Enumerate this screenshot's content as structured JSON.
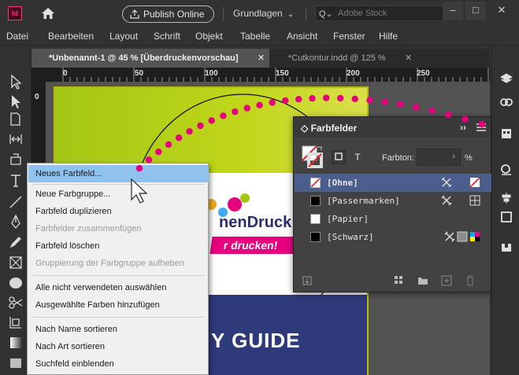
{
  "titlebar": {
    "app_logo": "Id",
    "publish_label": "Publish Online",
    "workspace_label": "Grundlagen",
    "search_placeholder": "Adobe Stock",
    "minimize": "–",
    "maximize": "□",
    "close": "✕"
  },
  "menu": [
    "Datei",
    "Bearbeiten",
    "Layout",
    "Schrift",
    "Objekt",
    "Tabelle",
    "Ansicht",
    "Fenster",
    "Hilfe"
  ],
  "tabs": [
    {
      "label": "*Unbenannt-1 @ 45 % [Überdruckenvorschau]",
      "close": "✕"
    },
    {
      "label": "*Cutkontur.indd @ 125 %",
      "close": "✕"
    }
  ],
  "ruler": {
    "ticks": [
      "0",
      "50",
      "100",
      "150",
      "200",
      "250"
    ],
    "side": "0"
  },
  "document": {
    "logo_prefix": "nen",
    "logo_word": "Druck",
    "slogan": "r drucken!",
    "guide": "Y GUIDE"
  },
  "swatches_panel": {
    "title": "Farbfelder",
    "collapse": "››",
    "tint_label": "Farbton:",
    "tint_unit": "%",
    "text_toggle": "T",
    "rows": [
      {
        "name": "[Ohne]",
        "selected": true
      },
      {
        "name": "[Passermarken]",
        "selected": false
      },
      {
        "name": "[Papier]",
        "selected": false
      },
      {
        "name": "[Schwarz]",
        "selected": false
      }
    ]
  },
  "context_menu": {
    "items": [
      {
        "label": "Neues Farbfeld...",
        "state": "highlighted"
      },
      {
        "label": "Neue Farbgruppe...",
        "state": "normal"
      },
      {
        "label": "Farbfeld duplizieren",
        "state": "normal"
      },
      {
        "label": "Farbfelder zusammenfügen",
        "state": "disabled"
      },
      {
        "label": "Farbfeld löschen",
        "state": "normal"
      },
      {
        "label": "Gruppierung der Farbgruppe aufheben",
        "state": "disabled"
      },
      {
        "label": "Alle nicht verwendeten auswählen",
        "state": "normal"
      },
      {
        "label": "Ausgewählte Farben hinzufügen",
        "state": "normal"
      },
      {
        "label": "Nach Name sortieren",
        "state": "normal"
      },
      {
        "label": "Nach Art sortieren",
        "state": "normal"
      },
      {
        "label": "Suchfeld einblenden",
        "state": "normal"
      }
    ]
  },
  "colors": {
    "accent_magenta": "#e6007e",
    "selection_blue": "#4b5e8c",
    "menu_highlight": "#8fc2ef",
    "page_frame": "#b6bd0b"
  }
}
